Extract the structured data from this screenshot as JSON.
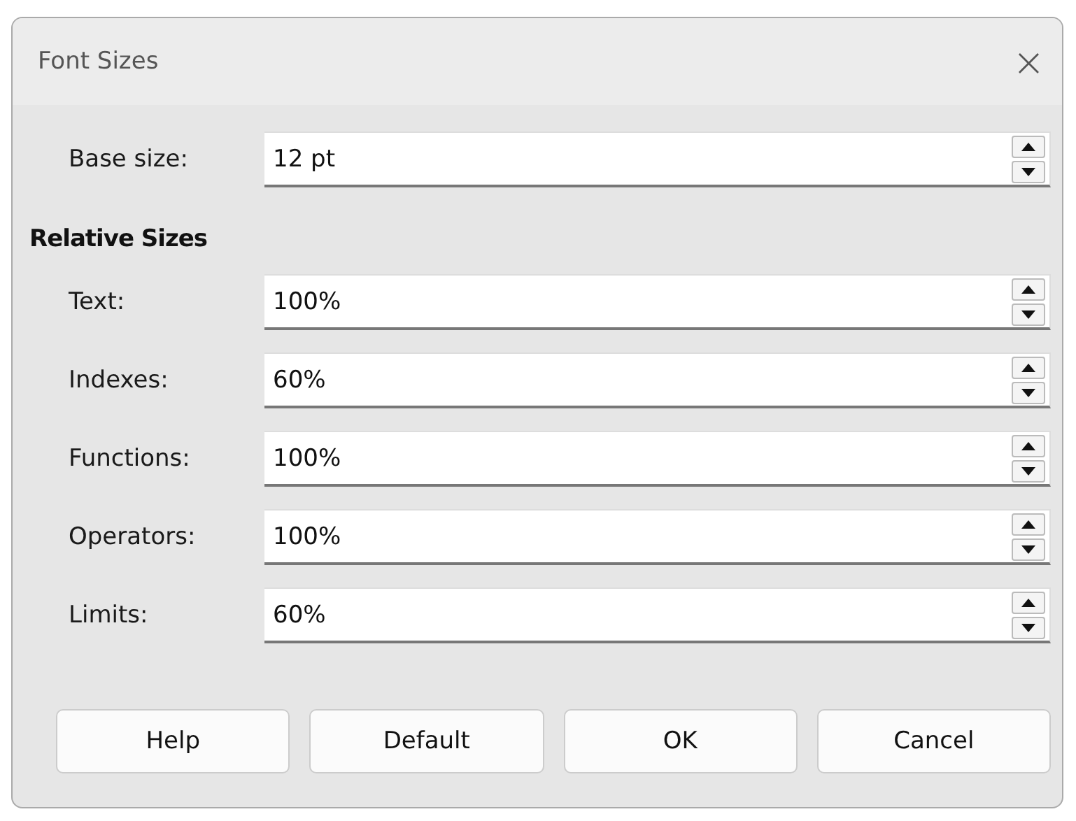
{
  "window": {
    "title": "Font Sizes",
    "close": "×"
  },
  "base_size": {
    "label": "Base size:",
    "value": "12 pt"
  },
  "relative_sizes": {
    "heading": "Relative Sizes",
    "rows": [
      {
        "label": "Text:",
        "value": "100%"
      },
      {
        "label": "Indexes:",
        "value": "60%"
      },
      {
        "label": "Functions:",
        "value": "100%"
      },
      {
        "label": "Operators:",
        "value": "100%"
      },
      {
        "label": "Limits:",
        "value": "60%"
      }
    ]
  },
  "buttons": [
    "Help",
    "Default",
    "OK",
    "Cancel"
  ]
}
